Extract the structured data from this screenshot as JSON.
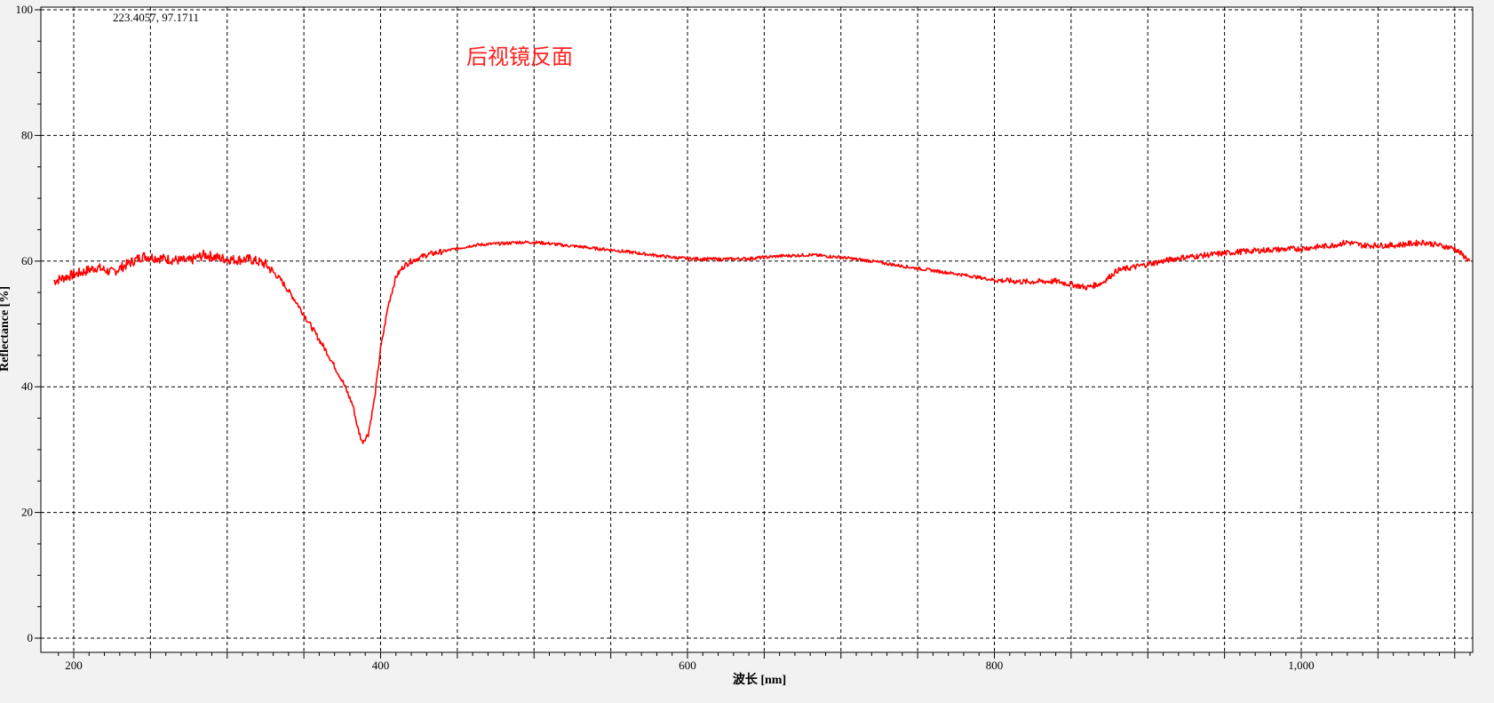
{
  "chart_data": {
    "type": "line",
    "title": "",
    "annotation": "后视镜反面",
    "cursor_readout": "223.4057, 97.1711",
    "xlabel": "波长 [nm]",
    "ylabel": "Reflectance [%]",
    "xlim": [
      182,
      1115
    ],
    "ylim": [
      0,
      100
    ],
    "x_major_ticks": [
      200,
      400,
      600,
      800,
      1000
    ],
    "x_tick_labels": [
      "200",
      "400",
      "600",
      "800",
      "1,000"
    ],
    "y_major_ticks": [
      0,
      20,
      40,
      60,
      80,
      100
    ],
    "y_tick_labels": [
      "0",
      "20",
      "40",
      "60",
      "80",
      "100"
    ],
    "grid": true,
    "colors": {
      "series": "#ff0000",
      "annotation": "#ff2020",
      "grid": "#000000",
      "plot_bg": "#ffffff",
      "window_bg": "#f2f2f2"
    },
    "series": [
      {
        "x": [
          187,
          195,
          205,
          215,
          225,
          235,
          245,
          255,
          265,
          275,
          285,
          295,
          305,
          315,
          325,
          335,
          345,
          355,
          365,
          375,
          382,
          385,
          388,
          392,
          396,
          400,
          405,
          410,
          415,
          420,
          425,
          430,
          440,
          450,
          460,
          470,
          480,
          490,
          500,
          510,
          520,
          530,
          540,
          550,
          560,
          570,
          580,
          590,
          600,
          620,
          640,
          660,
          680,
          700,
          720,
          740,
          760,
          780,
          800,
          820,
          840,
          860,
          870,
          880,
          900,
          920,
          940,
          960,
          980,
          1000,
          1020,
          1030,
          1040,
          1060,
          1080,
          1100,
          1110
        ],
        "y": [
          56.8,
          57.5,
          58.2,
          59.0,
          58.2,
          59.5,
          60.8,
          60.5,
          60.2,
          60.0,
          61.0,
          60.5,
          60.2,
          60.3,
          59.5,
          57.0,
          53.5,
          49.5,
          45.5,
          41.0,
          37.0,
          33.5,
          31.2,
          32.5,
          38.0,
          46.0,
          53.0,
          57.5,
          59.2,
          60.0,
          60.5,
          61.0,
          61.5,
          62.0,
          62.5,
          62.7,
          62.8,
          63.0,
          63.0,
          62.8,
          62.5,
          62.3,
          62.0,
          61.8,
          61.5,
          61.2,
          60.9,
          60.6,
          60.4,
          60.3,
          60.4,
          60.8,
          61.0,
          60.6,
          60.0,
          59.2,
          58.5,
          57.8,
          57.0,
          56.7,
          56.8,
          55.8,
          56.5,
          58.5,
          59.5,
          60.5,
          61.0,
          61.5,
          61.8,
          62.0,
          62.5,
          63.0,
          62.5,
          62.5,
          63.0,
          62.0,
          60.0
        ]
      }
    ]
  }
}
